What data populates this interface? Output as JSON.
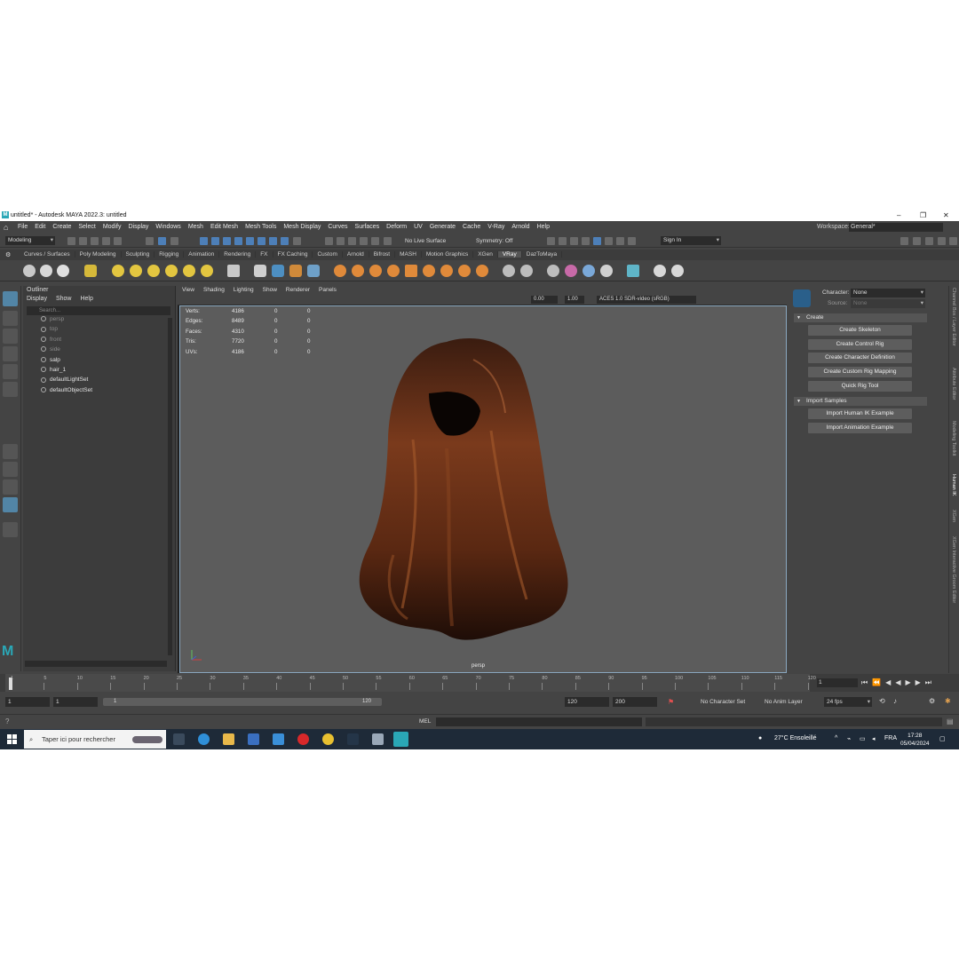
{
  "window": {
    "title": "untitled* - Autodesk MAYA 2022.3: untitled",
    "minimize": "–",
    "restore": "❐",
    "close": "✕"
  },
  "menubar": {
    "items": [
      "File",
      "Edit",
      "Create",
      "Select",
      "Modify",
      "Display",
      "Windows",
      "Mesh",
      "Edit Mesh",
      "Mesh Tools",
      "Mesh Display",
      "Curves",
      "Surfaces",
      "Deform",
      "UV",
      "Generate",
      "Cache",
      "V-Ray",
      "Arnold",
      "Help"
    ],
    "workspace_label": "Workspace:",
    "workspace_value": "General*"
  },
  "statusline": {
    "mode": "Modeling",
    "live_surface": "No Live Surface",
    "symmetry": "Symmetry: Off",
    "sign_in": "Sign In"
  },
  "shelf": {
    "tabs": [
      "Curves / Surfaces",
      "Poly Modeling",
      "Sculpting",
      "Rigging",
      "Animation",
      "Rendering",
      "FX",
      "FX Caching",
      "Custom",
      "Arnold",
      "Bifrost",
      "MASH",
      "Motion Graphics",
      "XGen",
      "VRay",
      "DazToMaya"
    ],
    "active_tab": "VRay"
  },
  "outliner": {
    "title": "Outliner",
    "menu": [
      "Display",
      "Show",
      "Help"
    ],
    "search_placeholder": "Search...",
    "items": [
      {
        "label": "persp",
        "dim": true
      },
      {
        "label": "top",
        "dim": true
      },
      {
        "label": "front",
        "dim": true
      },
      {
        "label": "side",
        "dim": true
      },
      {
        "label": "salp",
        "dim": false
      },
      {
        "label": "hair_1",
        "dim": false
      },
      {
        "label": "defaultLightSet",
        "dim": false
      },
      {
        "label": "defaultObjectSet",
        "dim": false
      }
    ]
  },
  "viewport": {
    "menu": [
      "View",
      "Shading",
      "Lighting",
      "Show",
      "Renderer",
      "Panels"
    ],
    "exposure": "0.00",
    "gamma": "1.00",
    "colorspace": "ACES 1.0 SDR-video (sRGB)",
    "camera": "persp",
    "hud": [
      {
        "label": "Verts:",
        "v1": "4186",
        "v2": "0",
        "v3": "0"
      },
      {
        "label": "Edges:",
        "v1": "8489",
        "v2": "0",
        "v3": "0"
      },
      {
        "label": "Faces:",
        "v1": "4310",
        "v2": "0",
        "v3": "0"
      },
      {
        "label": "Tris:",
        "v1": "7720",
        "v2": "0",
        "v3": "0"
      },
      {
        "label": "UVs:",
        "v1": "4186",
        "v2": "0",
        "v3": "0"
      }
    ]
  },
  "humanik": {
    "character_label": "Character:",
    "character_value": "None",
    "source_label": "Source:",
    "source_value": "None",
    "create_section": "Create",
    "create_buttons": [
      "Create Skeleton",
      "Create Control Rig",
      "Create Character Definition",
      "Create Custom Rig Mapping",
      "Quick Rig Tool"
    ],
    "import_section": "Import Samples",
    "import_buttons": [
      "Import Human IK Example",
      "Import Animation Example"
    ]
  },
  "side_tabs": [
    "Channel Box / Layer Editor",
    "Attribute Editor",
    "Modeling Toolkit",
    "Human IK",
    "XGen",
    "XGen Interactive Groom Editor"
  ],
  "timeslider": {
    "ticks": [
      "5",
      "10",
      "15",
      "20",
      "25",
      "30",
      "35",
      "40",
      "45",
      "50",
      "55",
      "60",
      "65",
      "70",
      "75",
      "80",
      "85",
      "90",
      "95",
      "100",
      "105",
      "110",
      "115",
      "120"
    ],
    "start_tick": "1",
    "current_frame": "1"
  },
  "range": {
    "start": "1",
    "inner_start": "1",
    "bar_start": "1",
    "bar_end": "120",
    "end": "120",
    "anim_end": "200",
    "character_set": "No Character Set",
    "anim_layer": "No Anim Layer",
    "fps": "24 fps"
  },
  "cmdline": {
    "label": "MEL"
  },
  "taskbar": {
    "search_placeholder": "Taper ici pour rechercher",
    "weather": "27°C  Ensoleillé",
    "lang": "FRA",
    "time": "17:28",
    "date": "05/04/2024"
  }
}
